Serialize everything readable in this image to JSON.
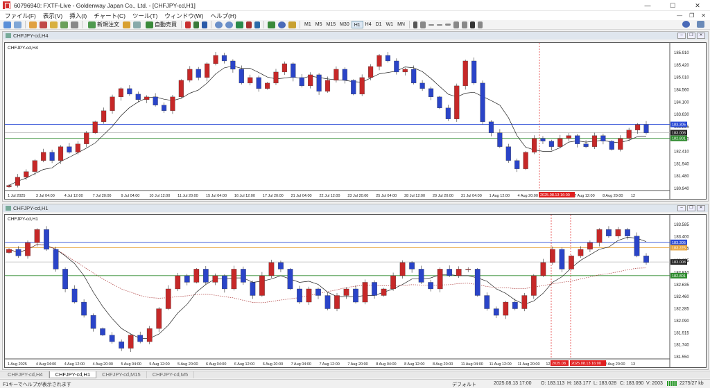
{
  "window": {
    "title": "60796940: FXTF-Live - Goldenway Japan Co., Ltd. - [CHFJPY-cd,H1]",
    "controls": [
      "—",
      "☐",
      "✕"
    ]
  },
  "menu": {
    "items": [
      "ファイル(F)",
      "表示(V)",
      "挿入(I)",
      "チャート(C)",
      "ツール(T)",
      "ウィンドウ(W)",
      "ヘルプ(H)"
    ],
    "mdi_controls": [
      "—",
      "❐",
      "✕"
    ]
  },
  "toolbar": {
    "new_order_label": "新規注文",
    "auto_trade_label": "自動売買",
    "timeframes": [
      "M1",
      "M5",
      "M15",
      "M30",
      "H1",
      "H4",
      "D1",
      "W1",
      "MN"
    ],
    "active_timeframe": "H1"
  },
  "chart_h4": {
    "window_title": "CHFJPY-cd,H4",
    "label": "CHFJPY-cd,H4",
    "price_axis": [
      "185.910",
      "185.420",
      "185.010",
      "184.560",
      "184.100",
      "183.630",
      "183.225",
      "182.820",
      "182.410",
      "181.940",
      "181.480",
      "180.940"
    ],
    "line_tags": [
      {
        "text": "183.305",
        "bg": "#2b4bd6"
      },
      {
        "text": "183.008",
        "bg": "#222222"
      },
      {
        "text": "182.801",
        "bg": "#2e8b2e"
      }
    ],
    "time_axis": [
      "1 Jul 2025",
      "3 Jul 04:00",
      "4 Jul 12:00",
      "7 Jul 20:00",
      "9 Jul 04:00",
      "10 Jul 12:00",
      "11 Jul 20:00",
      "15 Jul 04:00",
      "16 Jul 12:00",
      "17 Jul 20:00",
      "21 Jul 04:00",
      "22 Jul 12:00",
      "23 Jul 20:00",
      "25 Jul 04:00",
      "28 Jul 12:00",
      "29 Jul 20:00",
      "31 Jul 04:00",
      "1 Aug 12:00",
      "4 Aug 20:00",
      "6 Aug 04:00",
      "7 Aug 12:00",
      "8 Aug 20:00",
      "12"
    ],
    "time_highlight": "2025.08.13 16:00"
  },
  "chart_h1": {
    "window_title": "CHFJPY-cd,H1",
    "label": "CHFJPY-cd,H1",
    "price_axis": [
      "183.585",
      "183.400",
      "183.225",
      "183.055",
      "182.810",
      "182.635",
      "182.460",
      "182.285",
      "182.090",
      "181.915",
      "181.740",
      "181.550"
    ],
    "line_tags": [
      {
        "text": "183.305",
        "bg": "#2b4bd6"
      },
      {
        "text": "183.225",
        "bg": "#e8a640"
      },
      {
        "text": "183.008",
        "bg": "#222222"
      },
      {
        "text": "182.801",
        "bg": "#2e8b2e"
      }
    ],
    "time_axis": [
      "1 Aug 2025",
      "4 Aug 04:00",
      "4 Aug 12:00",
      "4 Aug 20:00",
      "5 Aug 04:00",
      "5 Aug 12:00",
      "5 Aug 20:00",
      "6 Aug 04:00",
      "6 Aug 12:00",
      "6 Aug 20:00",
      "7 Aug 04:00",
      "7 Aug 12:00",
      "7 Aug 20:00",
      "8 Aug 04:00",
      "8 Aug 12:00",
      "8 Aug 20:00",
      "11 Aug 04:00",
      "11 Aug 12:00",
      "11 Aug 20:00",
      "12 Aug 04:00",
      "12 Aug 12:00",
      "12 Aug 20:00",
      "13"
    ],
    "time_highlight_1": "2025.08.",
    "time_highlight_2": "2025.08.13 16:00"
  },
  "tabs": [
    "CHFJPY-cd,H4",
    "CHFJPY-cd,H1",
    "CHFJPY-cd,M15",
    "CHFJPY-cd,M5"
  ],
  "active_tab": "CHFJPY-cd,H1",
  "status": {
    "help": "F1キーでヘルプが表示されます",
    "profile": "デフォルト",
    "datetime": "2025.08.13 17:00",
    "open": "O: 183.113",
    "high": "H: 183.177",
    "low": "L: 183.028",
    "close": "C: 183.090",
    "volume": "V: 2003",
    "traffic": "2275/27 kb"
  },
  "chart_data": [
    {
      "type": "candlestick",
      "symbol": "CHFJPY-cd",
      "timeframe": "H4",
      "ylim": [
        180.94,
        186.1
      ],
      "horizontal_lines": [
        183.305,
        183.008,
        182.801
      ],
      "x_range": [
        "1 Jul 2025",
        "2025.08.13 16:00"
      ],
      "close_path": [
        181.1,
        181.4,
        181.6,
        182.0,
        182.3,
        182.0,
        182.5,
        182.3,
        182.6,
        183.0,
        183.4,
        183.8,
        184.3,
        184.6,
        184.4,
        184.2,
        184.3,
        184.0,
        183.8,
        184.3,
        184.9,
        185.3,
        185.0,
        185.5,
        185.8,
        185.6,
        185.3,
        184.8,
        185.0,
        184.6,
        184.8,
        185.2,
        185.5,
        185.0,
        184.7,
        185.1,
        184.5,
        184.9,
        185.3,
        184.9,
        184.4,
        185.0,
        185.4,
        185.8,
        185.6,
        185.2,
        185.3,
        184.8,
        184.6,
        184.3,
        183.9,
        183.5,
        184.7,
        185.6,
        184.8,
        183.4,
        183.0,
        182.5,
        182.0,
        181.7,
        182.3,
        182.8,
        182.7,
        182.5,
        182.8,
        182.9,
        182.6,
        182.5,
        182.9,
        182.7,
        182.4,
        182.8,
        183.1,
        183.3,
        183.0
      ]
    },
    {
      "type": "candlestick",
      "symbol": "CHFJPY-cd",
      "timeframe": "H1",
      "ylim": [
        181.55,
        183.66
      ],
      "horizontal_lines": [
        183.305,
        183.225,
        183.008,
        182.801
      ],
      "x_range": [
        "1 Aug 2025",
        "2025.08.13 16:00"
      ],
      "close_path": [
        183.2,
        183.1,
        183.3,
        183.5,
        183.2,
        182.9,
        182.6,
        182.4,
        182.2,
        182.0,
        181.9,
        181.8,
        181.7,
        181.9,
        181.8,
        182.0,
        182.3,
        182.6,
        182.8,
        182.7,
        182.9,
        182.7,
        182.8,
        182.6,
        182.9,
        182.7,
        182.5,
        182.8,
        183.0,
        182.9,
        182.6,
        182.4,
        182.6,
        182.5,
        182.3,
        182.5,
        182.6,
        182.4,
        182.7,
        182.5,
        182.6,
        182.8,
        183.0,
        182.9,
        182.7,
        182.6,
        182.9,
        182.8,
        182.9,
        182.9,
        182.5,
        182.3,
        182.2,
        182.4,
        182.3,
        182.5,
        182.8,
        183.0,
        183.2,
        182.9,
        183.1,
        183.2,
        183.3,
        183.5,
        183.4,
        183.5,
        183.4,
        183.1,
        183.0
      ]
    }
  ]
}
